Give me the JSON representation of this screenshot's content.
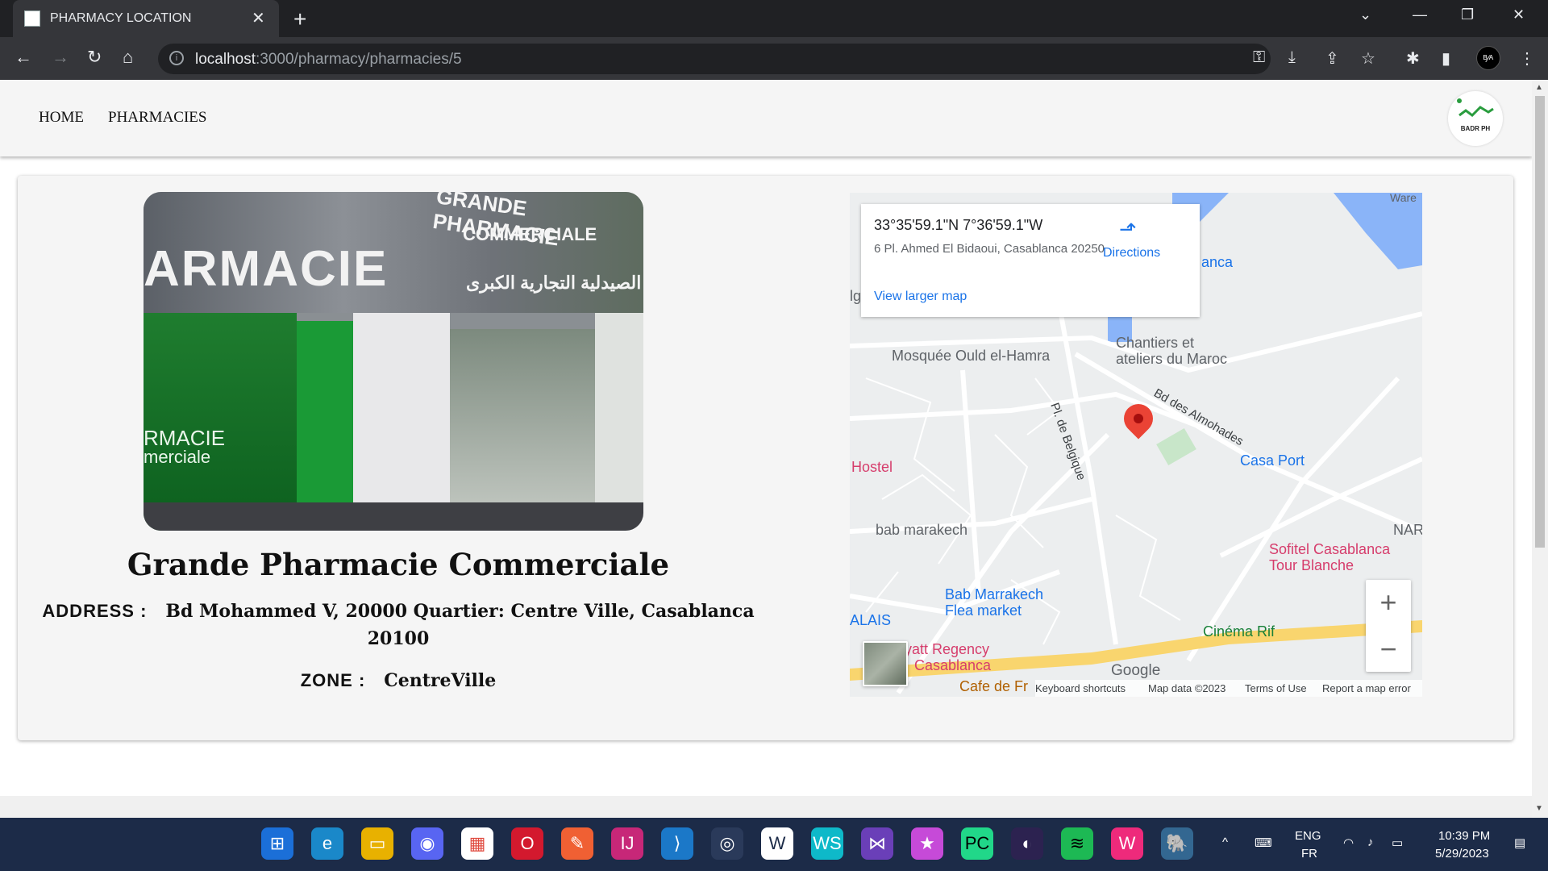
{
  "browser": {
    "tab_title": "PHARMACY LOCATION",
    "tab_close": "✕",
    "new_tab": "+",
    "url_host": "localhost",
    "url_path": ":3000/pharmacy/pharmacies/5",
    "profile_initials": "ᴮ⁄ᴬ"
  },
  "nav": {
    "home": "HOME",
    "pharmacies": "PHARMACIES",
    "logo_text": "BADR PH"
  },
  "photo_sign": {
    "big": "ARMACIE",
    "top": "GRANDE PHARMACIE",
    "top2": "COMMERCIALE",
    "arabic": "الصيدلية التجارية الكبرى",
    "window1": "RMACIE",
    "window2": "merciale"
  },
  "pharmacy": {
    "name": "Grande Pharmacie Commerciale",
    "address_label": "ADDRESS :",
    "address_value": "Bd Mohammed V, 20000 Quartier: Centre Ville, Casablanca 20100",
    "zone_label": "ZONE :",
    "zone_value": "CentreVille"
  },
  "map": {
    "coords": "33°35'59.1\"N 7°36'59.1\"W",
    "address": "6 Pl. Ahmed El Bidaoui, Casablanca 20250",
    "view_larger": "View larger map",
    "directions": "Directions",
    "labels": {
      "ware": "Ware",
      "anca": "anca",
      "ig": "lg",
      "mosquee": "Mosquée Ould el-Hamra",
      "chantiers1": "Chantiers et",
      "chantiers2": "ateliers du Maroc",
      "bd_almohades": "Bd des Almohades",
      "pl_belgique": "Pl. de Belgique",
      "hostel": "Hostel",
      "casa_port": "Casa Port",
      "bab_marakech": "bab marakech",
      "nar": "NAR",
      "sofitel1": "Sofitel Casablanca",
      "sofitel2": "Tour Blanche",
      "bab_marrakech1": "Bab Marrakech",
      "bab_marrakech2": "Flea market",
      "alais": "ALAIS",
      "cinema": "Cinéma Rif",
      "regency1": "yatt Regency",
      "regency2": "Casablanca",
      "cafe": "Cafe de Fr"
    },
    "zoom_in": "+",
    "zoom_out": "−",
    "google": "Google",
    "footer": {
      "shortcuts": "Keyboard shortcuts",
      "data": "Map data ©2023",
      "terms": "Terms of Use",
      "report": "Report a map error"
    }
  },
  "taskbar": {
    "lang1": "ENG",
    "lang2": "FR",
    "time": "10:39 PM",
    "date": "5/29/2023"
  }
}
